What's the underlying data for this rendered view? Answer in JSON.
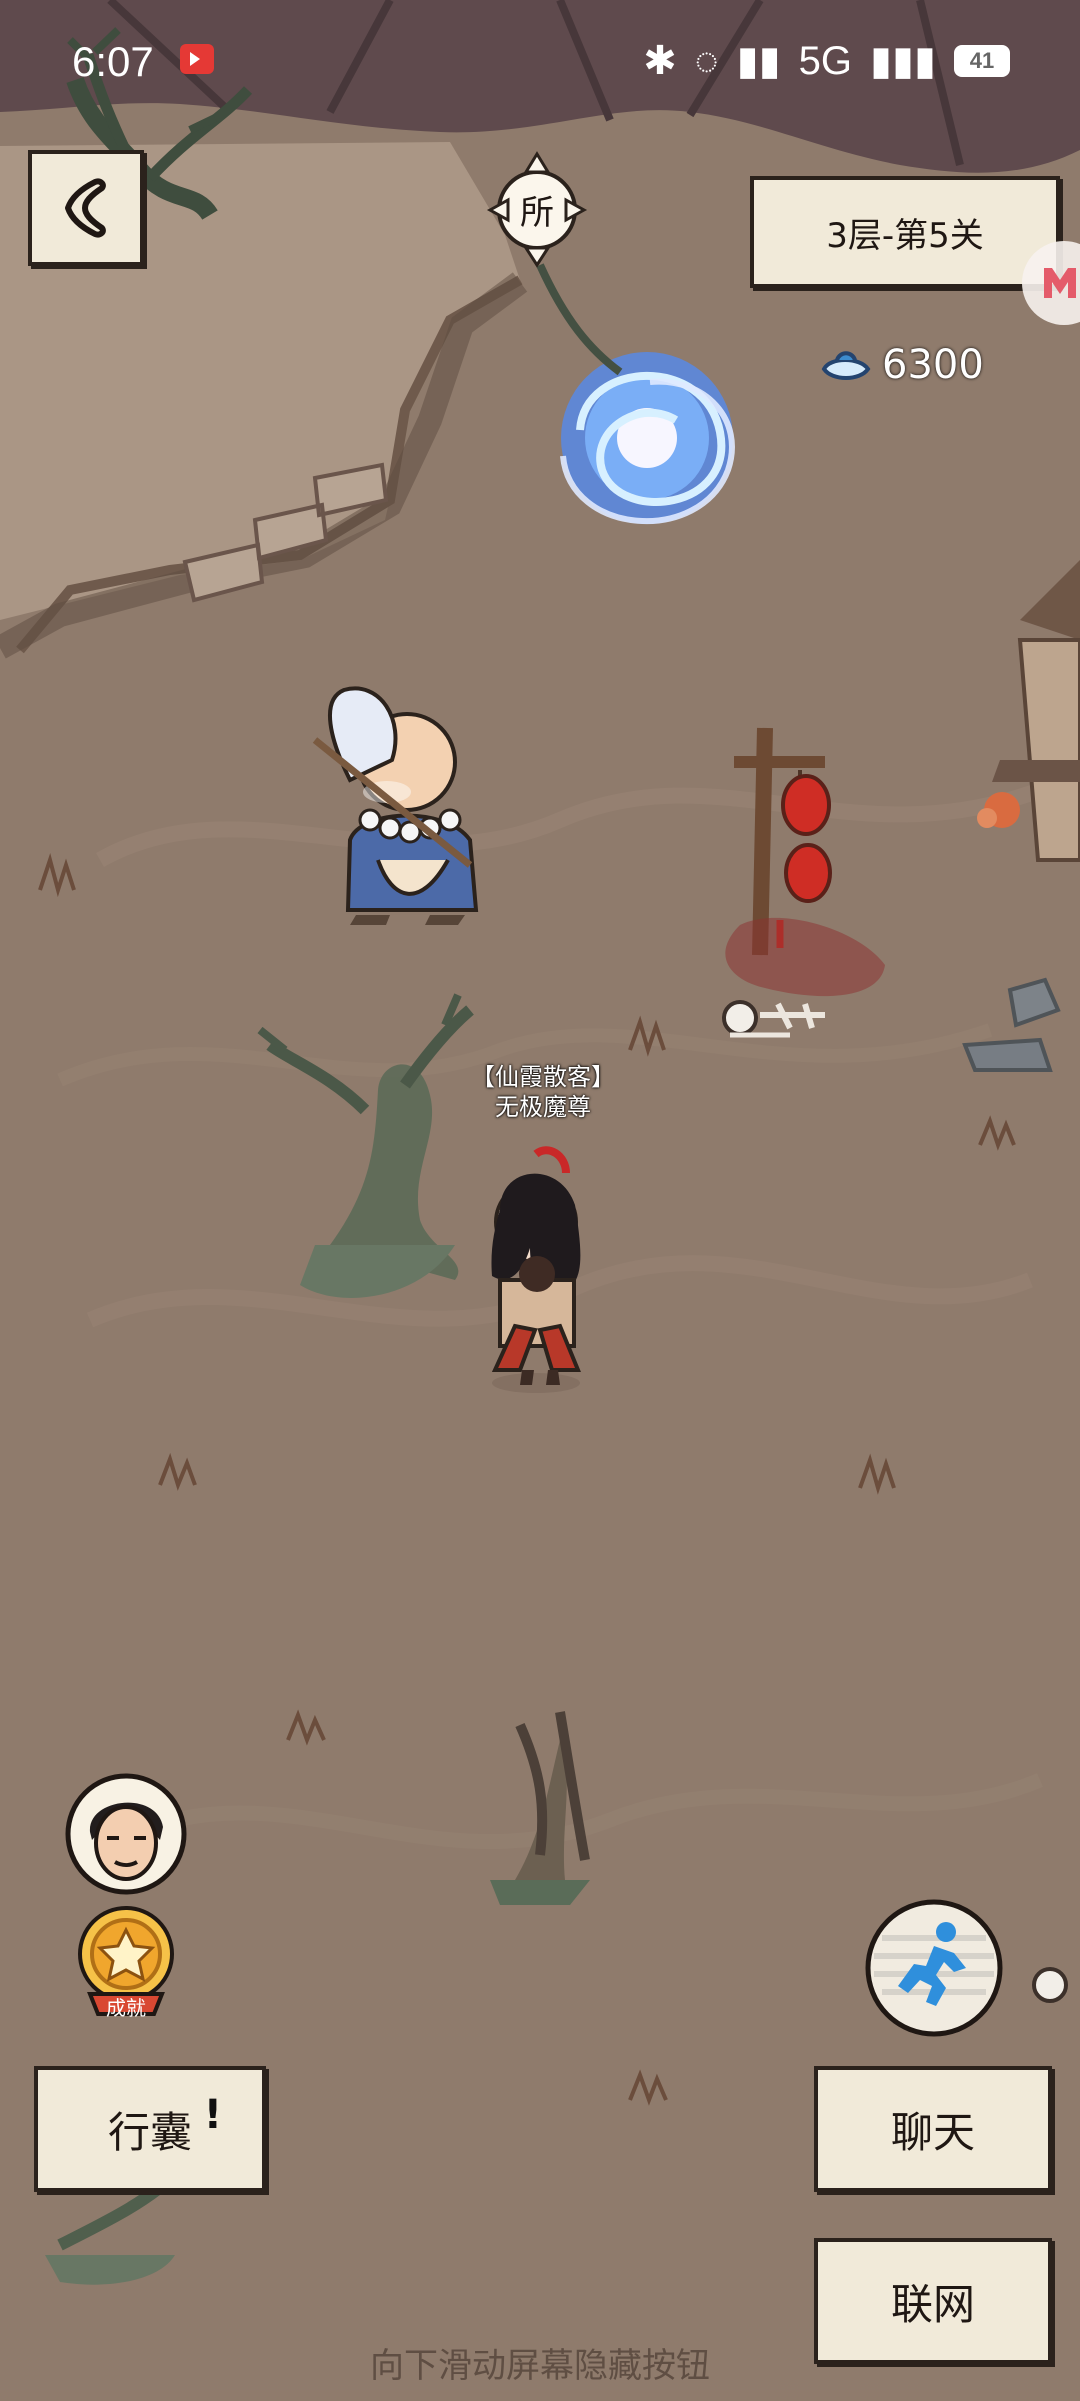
{
  "status_bar": {
    "time": "6:07",
    "battery": "41",
    "network": "5G"
  },
  "game": {
    "level_label": "3层-第5关",
    "currency_value": "6300",
    "sign_text": "所",
    "npc_title": "【仙霞散客】",
    "npc_name": "无极魔尊",
    "buttons": {
      "inventory": "行囊",
      "inventory_alert": "!",
      "chat": "聊天",
      "online": "联网"
    },
    "achievement_badge": "成就",
    "hint": "向下滑动屏幕隐藏按钮"
  },
  "colors": {
    "ground": "#8f7b6c",
    "paper": "#f1ead9",
    "border": "#2b221c"
  },
  "icons": {
    "back": "chevron-left-icon",
    "currency": "silver-ingot-icon",
    "run": "runner-icon",
    "achievement": "achievement-medal-icon"
  }
}
